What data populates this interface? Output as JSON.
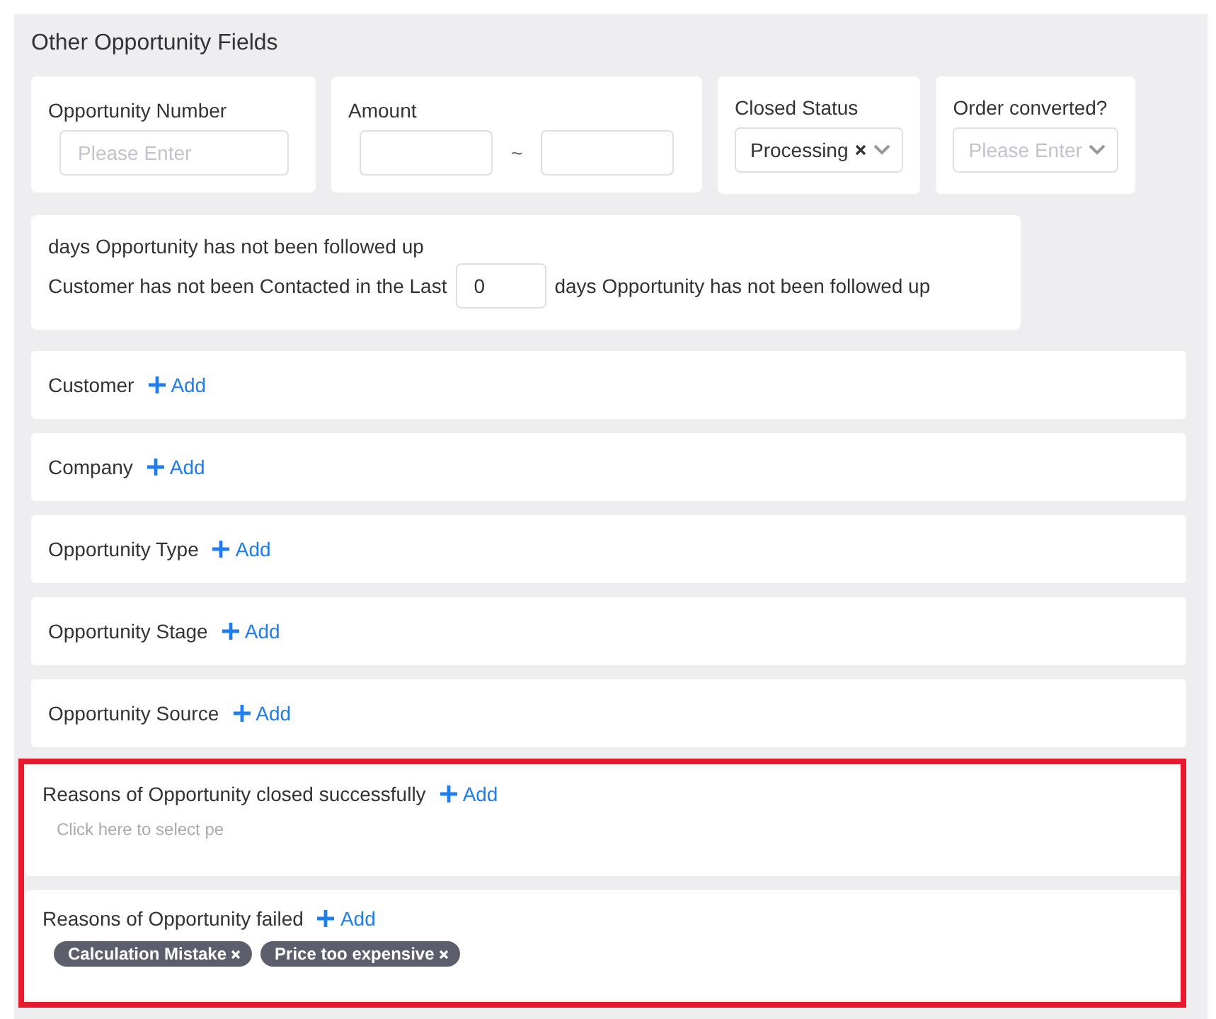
{
  "panel": {
    "title": "Other Opportunity Fields"
  },
  "filters": [
    {
      "kind": "text",
      "label": "Opportunity Number",
      "placeholder": "Please Enter"
    },
    {
      "kind": "range",
      "label": "Amount",
      "separator": "~"
    },
    {
      "kind": "select",
      "label": "Closed Status",
      "value": "Processing",
      "clearable": true
    },
    {
      "kind": "select",
      "label": "Order converted?",
      "placeholder": "Please Enter",
      "clearable": false
    }
  ],
  "followup": {
    "note": "days Opportunity has not been followed up",
    "prefix": "Customer has not been Contacted in the Last",
    "value": "0",
    "suffix": "days Opportunity has not been followed up"
  },
  "sections": [
    {
      "label": "Customer",
      "add": "Add",
      "highlighted": false
    },
    {
      "label": "Company",
      "add": "Add",
      "highlighted": false
    },
    {
      "label": "Opportunity Type",
      "add": "Add",
      "highlighted": false
    },
    {
      "label": "Opportunity Stage",
      "add": "Add",
      "highlighted": false
    },
    {
      "label": "Opportunity Source",
      "add": "Add",
      "highlighted": false
    },
    {
      "label": "Reasons of Opportunity closed successfully",
      "add": "Add",
      "placeholder": "Click here to select pe",
      "highlighted": true
    },
    {
      "label": "Reasons of Opportunity failed",
      "add": "Add",
      "tags": [
        "Calculation Mistake",
        "Price too expensive"
      ],
      "highlighted": true
    }
  ]
}
